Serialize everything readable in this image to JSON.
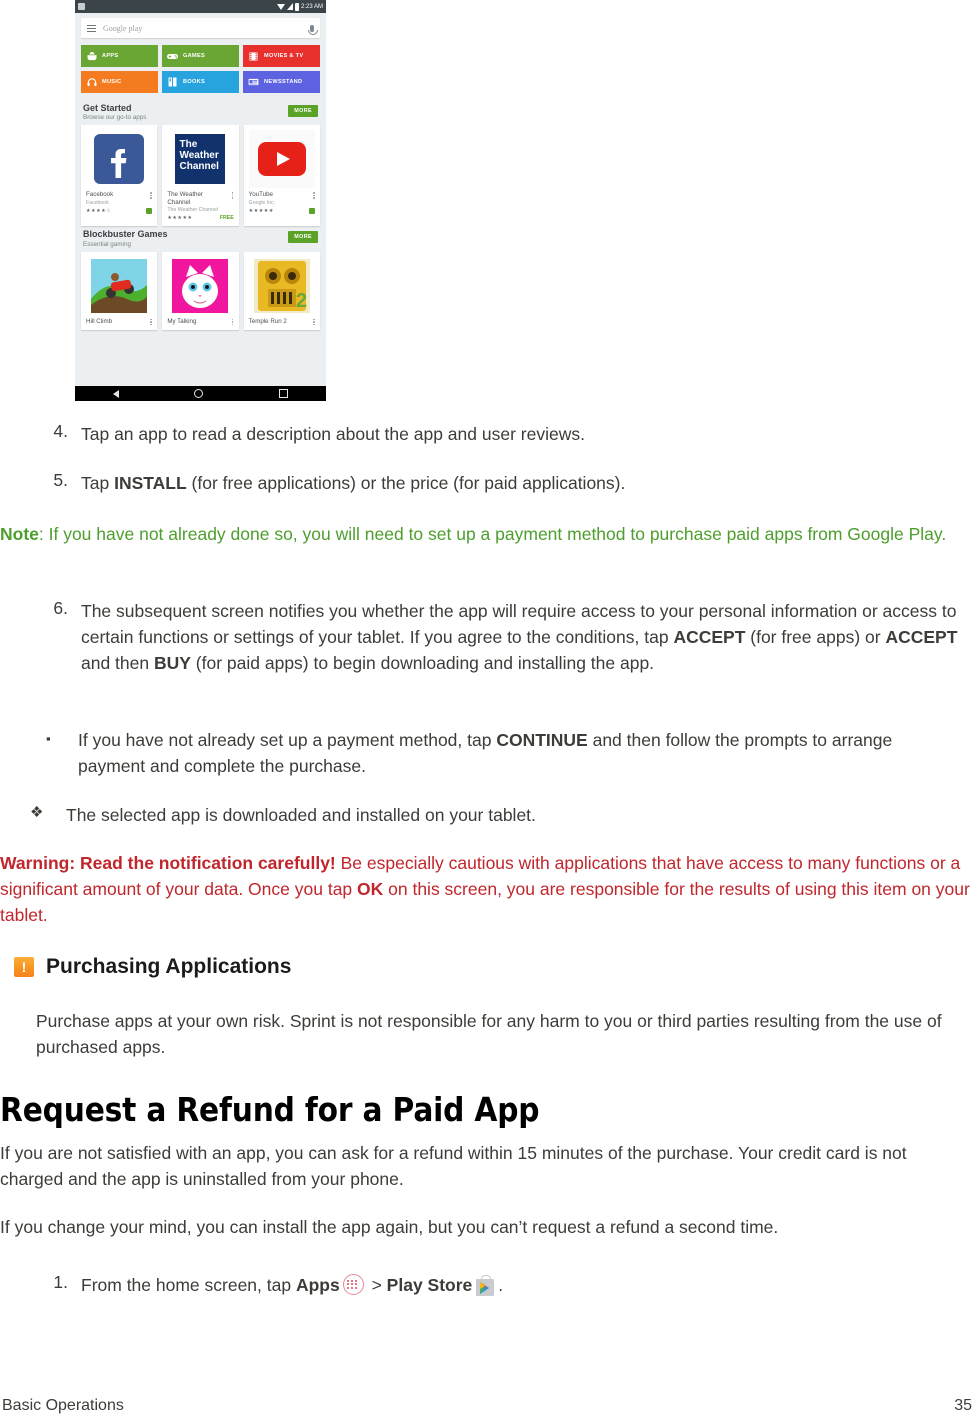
{
  "figure": {
    "name": "google-play-store-screenshot",
    "status_bar": {
      "time": "2:23 AM"
    },
    "search": {
      "placeholder": "Google play"
    },
    "categories": [
      {
        "label": "APPS",
        "color": "#6aa634",
        "icon": "android-icon"
      },
      {
        "label": "GAMES",
        "color": "#6aa634",
        "icon": "gamepad-icon"
      },
      {
        "label": "MOVIES & TV",
        "color": "#e8302c",
        "icon": "film-icon"
      },
      {
        "label": "MUSIC",
        "color": "#f47b20",
        "icon": "headphones-icon"
      },
      {
        "label": "BOOKS",
        "color": "#27a4dd",
        "icon": "book-icon"
      },
      {
        "label": "NEWSSTAND",
        "color": "#5d63e0",
        "icon": "newspaper-icon"
      }
    ],
    "sections": [
      {
        "title": "Get Started",
        "subtitle": "Browse our go-to apps",
        "more_label": "MORE",
        "cards": [
          {
            "name": "Facebook",
            "developer": "Facebook",
            "stars": "★★★★☆",
            "price": "",
            "art": "facebook",
            "badge": true
          },
          {
            "name": "The Weather Channel",
            "developer": "The Weather Channel",
            "stars": "★★★★★",
            "price": "FREE",
            "art": "weather",
            "badge": false
          },
          {
            "name": "YouTube",
            "developer": "Google Inc.",
            "stars": "★★★★★",
            "price": "",
            "art": "youtube",
            "badge": true
          }
        ]
      },
      {
        "title": "Blockbuster Games",
        "subtitle": "Essential gaming",
        "more_label": "MORE",
        "cards": [
          {
            "name": "Hill Climb",
            "developer": "",
            "stars": "",
            "price": "",
            "art": "hillclimb",
            "badge": false
          },
          {
            "name": "My Talking",
            "developer": "",
            "stars": "",
            "price": "",
            "art": "talkingangela",
            "badge": false
          },
          {
            "name": "Temple Run 2",
            "developer": "",
            "stars": "",
            "price": "",
            "art": "templerun",
            "badge": false
          }
        ]
      }
    ],
    "nav": [
      "back-icon",
      "home-icon",
      "recents-icon"
    ]
  },
  "steps": {
    "step4_num": "4.",
    "step4_text": "Tap an app to read a description about the app and user reviews.",
    "step5_num": "5.",
    "step5_a": "Tap ",
    "step5_b": "INSTALL",
    "step5_c": " (for free applications) or the price (for paid applications).",
    "step6_num": "6.",
    "step6_a": "The subsequent screen notifies you whether the app will require access to your personal information or access to certain functions or settings of your tablet. If you agree to the conditions, tap ",
    "step6_b1": "ACCEPT",
    "step6_c": " (for free apps) or ",
    "step6_b2": "ACCEPT",
    "step6_d": " and then ",
    "step6_b3": "BUY",
    "step6_e": " (for paid apps) to begin downloading and installing the app.",
    "step1_num": "1.",
    "step1_a": "From the home screen, tap ",
    "step1_b1": "Apps",
    "step1_sep": " > ",
    "step1_b2": "Play Store",
    "step1_end": "."
  },
  "bullets": {
    "square_marker": "▪",
    "square_a": "If you have not already set up a payment method, tap ",
    "square_b": "CONTINUE",
    "square_c": " and then follow the prompts to arrange payment and complete the purchase.",
    "diamond_marker": "❖",
    "diamond_text": "The selected app is downloaded and installed on your tablet."
  },
  "note": {
    "label": "Note",
    "text": ": If you have not already done so, you will need to set up a payment method to purchase paid apps from Google Play.",
    "color": "#4d9f2d"
  },
  "warning": {
    "label": "Warning: Read the notification carefully!",
    "text_a": " Be especially cautious with applications that have access to many functions or a significant amount of your data. Once you tap ",
    "bold_ok": "OK",
    "text_b": " on this screen, you are responsible for the results of using this item on your tablet.",
    "color": "#c1262c"
  },
  "purchasing": {
    "badge_glyph": "!",
    "badge_color": "#f7941e",
    "heading": "Purchasing Applications",
    "body": "Purchase apps at your own risk. Sprint is not responsible for any harm to you or third parties resulting from the use of purchased apps."
  },
  "refund": {
    "heading": "Request a Refund for a Paid App",
    "para1": "If you are not satisfied with an app, you can ask for a refund within 15 minutes of the purchase. Your credit card is not charged and the app is uninstalled from your phone.",
    "para2": "If you change your mind, you can install the app again, but you can’t request a refund a second time."
  },
  "footer": {
    "section": "Basic Operations",
    "page_number": "35"
  }
}
